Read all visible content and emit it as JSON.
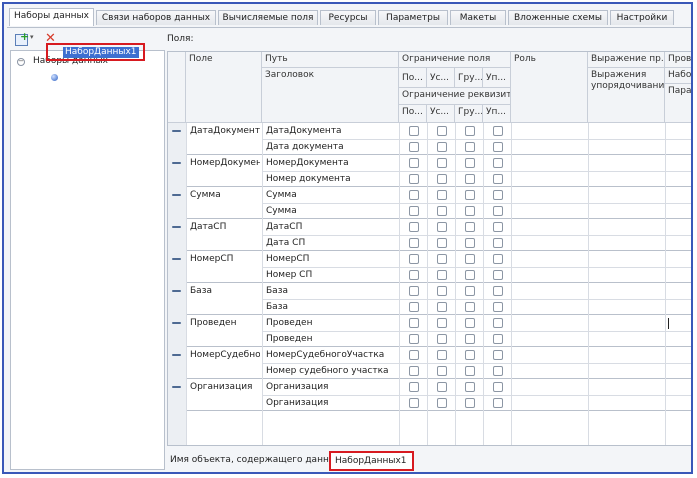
{
  "tabs": [
    {
      "label": "Наборы данных",
      "active": true
    },
    {
      "label": "Связи наборов данных"
    },
    {
      "label": "Вычисляемые поля"
    },
    {
      "label": "Ресурсы"
    },
    {
      "label": "Параметры"
    },
    {
      "label": "Макеты"
    },
    {
      "label": "Вложенные схемы"
    },
    {
      "label": "Настройки"
    }
  ],
  "toolbar": {
    "add_icon": "add-icon",
    "delete_icon": "delete-icon"
  },
  "tree": {
    "root": {
      "label": "Наборы данных",
      "expanded": true
    },
    "items": [
      {
        "label": "НаборДанных1",
        "selected": true
      }
    ]
  },
  "fields_label": "Поля:",
  "grid": {
    "headers": {
      "field": "Поле",
      "path": "Путь",
      "title": "Заголовок",
      "field_restriction": "Ограничение поля",
      "restriction_cols": [
        "По...",
        "Ус...",
        "Гру...",
        "Уп..."
      ],
      "attr_restriction": "Ограничение реквизит...",
      "attr_cols": [
        "По...",
        "Ус...",
        "Гру...",
        "Уп..."
      ],
      "role": "Роль",
      "expr": "Выражение пр...",
      "order_expr": "Выражения упорядочивания",
      "check": "Провер",
      "set": "Набор с",
      "params": "Парамe"
    },
    "rows": [
      {
        "field": "ДатаДокумент",
        "path": "ДатаДокумента",
        "title": "Дата документа"
      },
      {
        "field": "НомерДокумен",
        "path": "НомерДокумента",
        "title": "Номер документа"
      },
      {
        "field": "Сумма",
        "path": "Сумма",
        "title": "Сумма"
      },
      {
        "field": "ДатаСП",
        "path": "ДатаСП",
        "title": "Дата СП"
      },
      {
        "field": "НомерСП",
        "path": "НомерСП",
        "title": "Номер СП"
      },
      {
        "field": "База",
        "path": "База",
        "title": "База"
      },
      {
        "field": "Проведен",
        "path": "Проведен",
        "title": "Проведен"
      },
      {
        "field": "НомерСудебног",
        "path": "НомерСудебногоУчастка",
        "title": "Номер судебного участка"
      },
      {
        "field": "Организация",
        "path": "Организация",
        "title": "Организация"
      }
    ]
  },
  "bottom": {
    "label": "Имя объекта, содержащего данные:",
    "value": "НаборДанных1"
  },
  "colors": {
    "accent": "#3d6fd0",
    "highlight": "#d71a20",
    "frame": "#3a58b8"
  }
}
